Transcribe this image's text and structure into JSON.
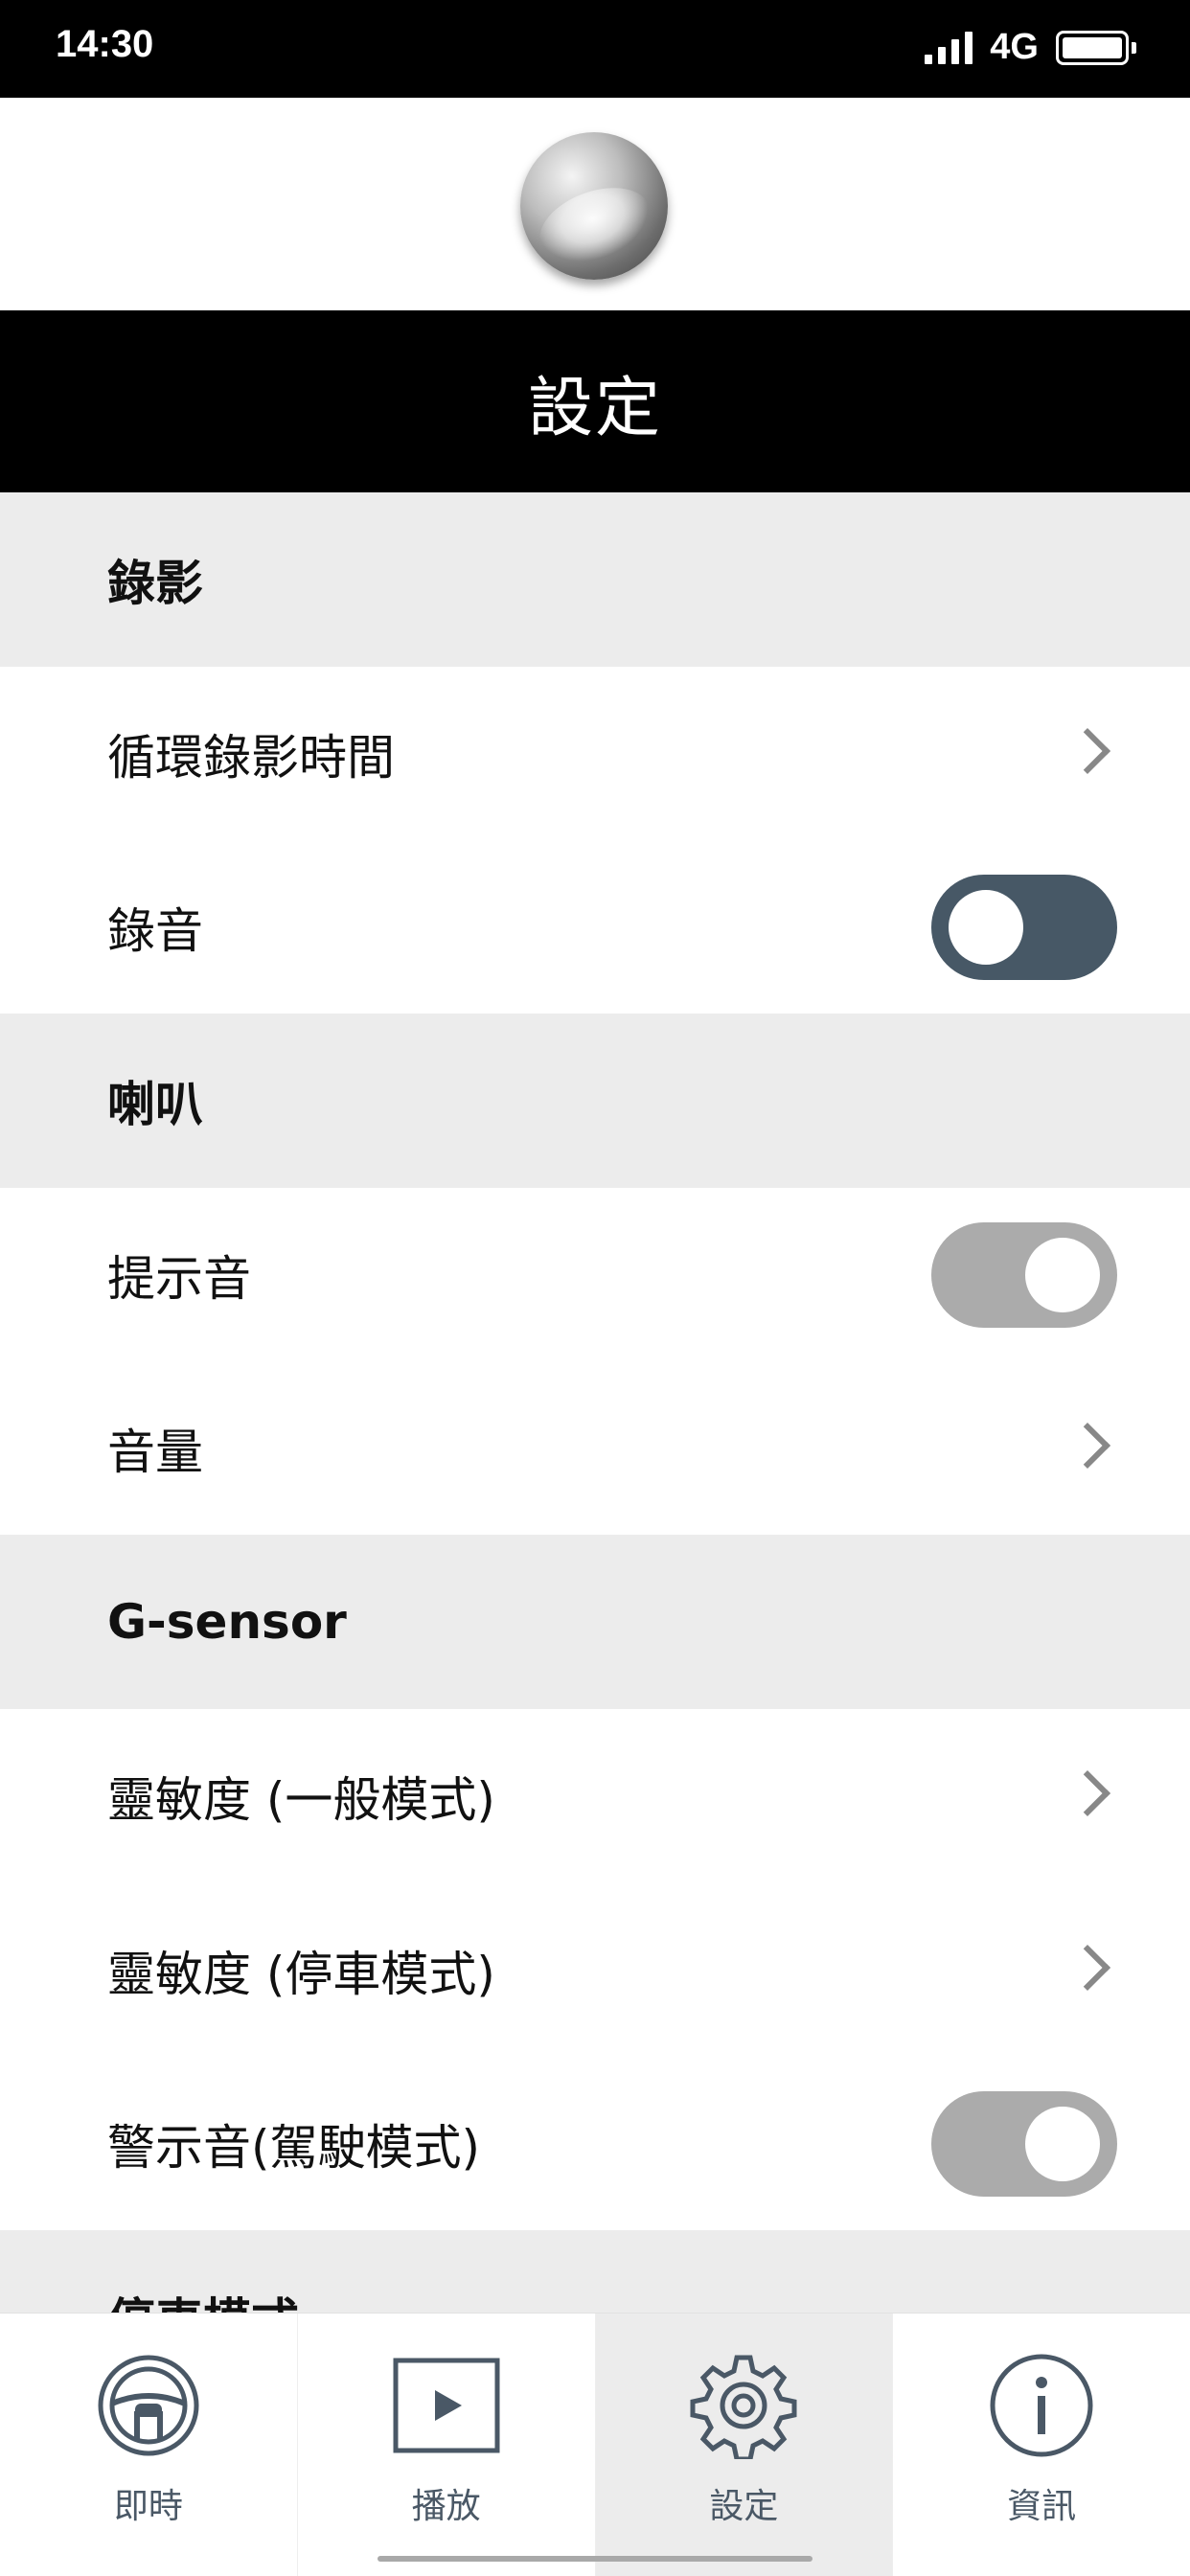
{
  "status_bar": {
    "time": "14:30",
    "network": "4G"
  },
  "header": {
    "title": "設定"
  },
  "sections": {
    "recording": {
      "label": "錄影",
      "loop_time": "循環錄影時間",
      "audio": "錄音",
      "audio_toggle": "off"
    },
    "speaker": {
      "label": "喇叭",
      "prompt_tone": "提示音",
      "prompt_tone_toggle": "on",
      "volume": "音量"
    },
    "gsensor": {
      "label": "G-sensor",
      "sensitivity_normal": "靈敏度 (一般模式)",
      "sensitivity_parking": "靈敏度 (停車模式)",
      "warning_tone": "警示音(駕駛模式)",
      "warning_tone_toggle": "on"
    },
    "parking": {
      "label": "停車模式"
    }
  },
  "tabs": {
    "live": "即時",
    "playback": "播放",
    "settings": "設定",
    "info": "資訊",
    "active": "settings"
  },
  "colors": {
    "toggle_on": "#ababab",
    "toggle_off": "#475866",
    "section_bg": "#ececec",
    "tab_icon": "#4a5866"
  }
}
